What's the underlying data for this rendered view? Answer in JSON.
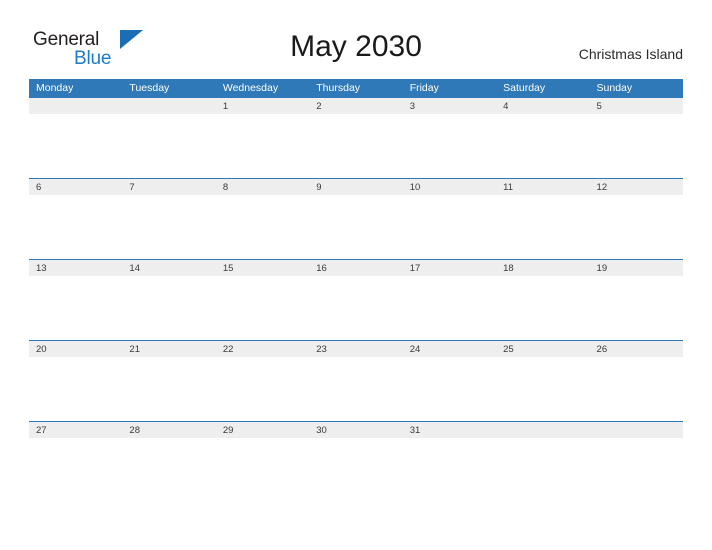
{
  "brand": {
    "name_part1": "General",
    "name_part2": "Blue",
    "flag_icon": "blue-triangle-flag",
    "accent_color": "#1b6eb3"
  },
  "header": {
    "title": "May 2030",
    "location": "Christmas Island"
  },
  "calendar": {
    "month": "May",
    "year": "2030",
    "header_bg_color": "#3079b8",
    "date_band_color": "#eeeeee",
    "weekday_headers": [
      "Monday",
      "Tuesday",
      "Wednesday",
      "Thursday",
      "Friday",
      "Saturday",
      "Sunday"
    ],
    "weeks": [
      {
        "days": [
          "",
          "",
          "1",
          "2",
          "3",
          "4",
          "5"
        ]
      },
      {
        "days": [
          "6",
          "7",
          "8",
          "9",
          "10",
          "11",
          "12"
        ]
      },
      {
        "days": [
          "13",
          "14",
          "15",
          "16",
          "17",
          "18",
          "19"
        ]
      },
      {
        "days": [
          "20",
          "21",
          "22",
          "23",
          "24",
          "25",
          "26"
        ]
      },
      {
        "days": [
          "27",
          "28",
          "29",
          "30",
          "31",
          "",
          ""
        ]
      }
    ]
  }
}
